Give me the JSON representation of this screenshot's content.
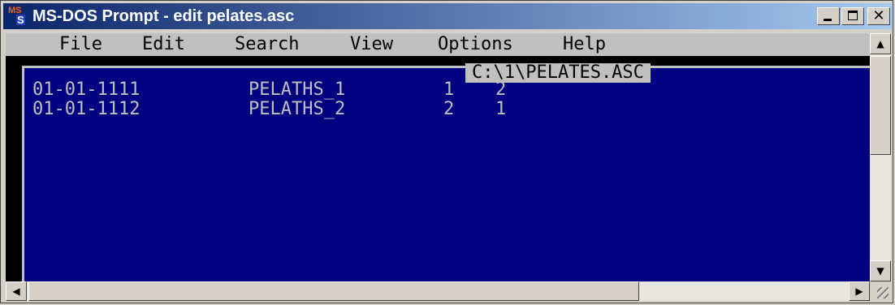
{
  "window": {
    "title": "MS-DOS Prompt - edit pelates.asc",
    "icon": "ms-dos-icon",
    "icon_text_top": "MS",
    "icon_text_bottom": "S"
  },
  "menu": {
    "items": [
      "File",
      "Edit",
      "Search",
      "View",
      "Options",
      "Help"
    ]
  },
  "editor": {
    "file_path": "C:\\1\\PELATES.ASC",
    "lines": [
      {
        "date": "01-01-1111",
        "name": "PELATHS_1",
        "a": "1",
        "b": "2"
      },
      {
        "date": "01-01-1112",
        "name": "PELATHS_2",
        "a": "2",
        "b": "1"
      }
    ]
  },
  "colors": {
    "titlebar_start": "#0a246a",
    "titlebar_end": "#a6caf0",
    "editor_bg": "#000080",
    "editor_text": "#c0c0c0"
  }
}
